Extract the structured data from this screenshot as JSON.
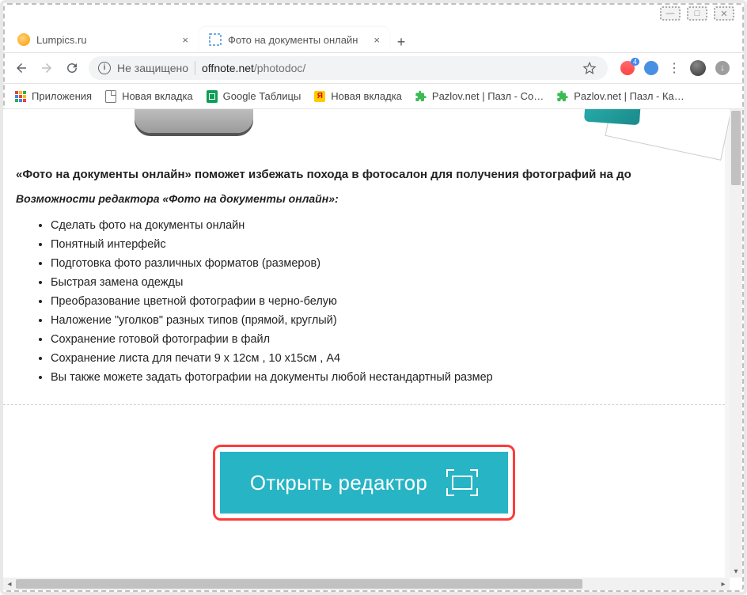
{
  "window": {
    "minimize": "—",
    "maximize": "□",
    "close": "✕"
  },
  "tabs": [
    {
      "title": "Lumpics.ru"
    },
    {
      "title": "Фото на документы онлайн"
    }
  ],
  "address": {
    "security_label": "Не защищено",
    "domain": "offnote.net",
    "path": "/photodoc/"
  },
  "ext": {
    "cart_badge": "4"
  },
  "bookmarks": {
    "apps": "Приложения",
    "items": [
      "Новая вкладка",
      "Google Таблицы",
      "Новая вкладка",
      "Pazlov.net | Пазл - Со…",
      "Pazlov.net | Пазл - Ка…"
    ]
  },
  "content": {
    "headline": "«Фото на документы онлайн» поможет избежать похода в фотосалон для получения фотографий на до",
    "subhead": "Возможности редактора «Фото на документы онлайн»:",
    "features": [
      "Сделать фото на документы онлайн",
      "Понятный интерфейс",
      "Подготовка фото различных форматов (размеров)",
      "Быстрая замена одежды",
      "Преобразование цветной фотографии в черно-белую",
      "Наложение \"уголков\" разных типов (прямой, круглый)",
      "Сохранение готовой фотографии в файл",
      "Сохранение листа для печати 9 x 12см , 10 x15см , A4",
      "Вы также можете задать фотографии на документы любой нестандартный размер"
    ],
    "cta_label": "Открыть редактор"
  },
  "colors": {
    "cta_bg": "#27b4c4",
    "highlight_border": "#ff3b3b"
  }
}
